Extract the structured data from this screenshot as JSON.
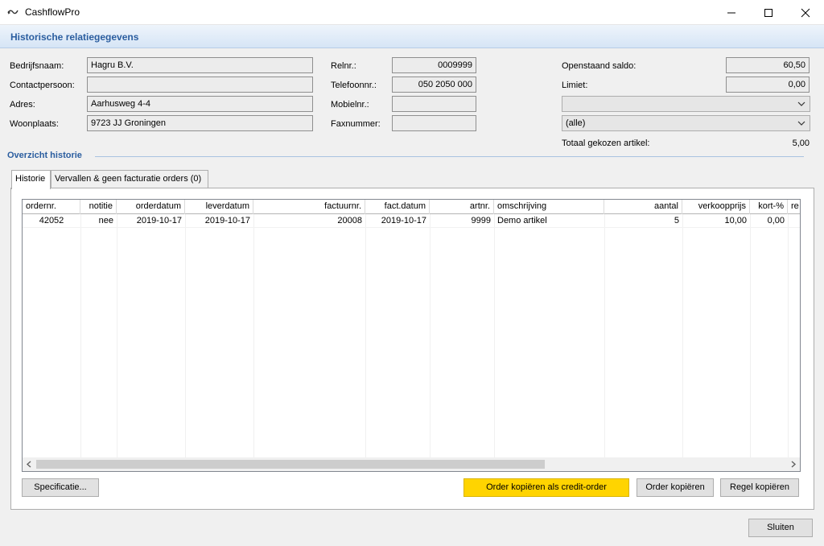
{
  "window": {
    "title": "CashflowPro"
  },
  "header": {
    "title": "Historische relatiegegevens"
  },
  "relation": {
    "bedrijfsnaam_label": "Bedrijfsnaam:",
    "bedrijfsnaam": "Hagru B.V.",
    "contactpersoon_label": "Contactpersoon:",
    "contactpersoon": "",
    "adres_label": "Adres:",
    "adres": "Aarhusweg 4-4",
    "woonplaats_label": "Woonplaats:",
    "woonplaats": "9723 JJ Groningen",
    "relnr_label": "Relnr.:",
    "relnr": "0009999",
    "telefoon_label": "Telefoonnr.:",
    "telefoon": "050 2050 000",
    "mobiel_label": "Mobielnr.:",
    "mobiel": "",
    "fax_label": "Faxnummer:",
    "fax": "",
    "saldo_label": "Openstaand saldo:",
    "saldo": "60,50",
    "limiet_label": "Limiet:",
    "limiet": "0,00",
    "combo1_value": "",
    "combo2_value": "(alle)",
    "totaal_label": "Totaal gekozen artikel:",
    "totaal": "5,00"
  },
  "history": {
    "section_title": "Overzicht historie",
    "tabs": [
      {
        "label": "Historie"
      },
      {
        "label": "Vervallen & geen facturatie orders (0)"
      }
    ],
    "columns": [
      "ordernr.",
      "notitie",
      "orderdatum",
      "leverdatum",
      "factuurnr.",
      "fact.datum",
      "artnr.",
      "omschrijving",
      "aantal",
      "verkoopprijs",
      "kort-%",
      "re"
    ],
    "rows": [
      [
        "42052",
        "nee",
        "2019-10-17",
        "2019-10-17",
        "20008",
        "2019-10-17",
        "9999",
        "Demo artikel",
        "5",
        "10,00",
        "0,00",
        ""
      ]
    ]
  },
  "buttons": {
    "specificatie": "Specificatie...",
    "order_credit": "Order kopiëren als credit-order",
    "order_kopieren": "Order kopiëren",
    "regel_kopieren": "Regel kopiëren",
    "sluiten": "Sluiten"
  }
}
